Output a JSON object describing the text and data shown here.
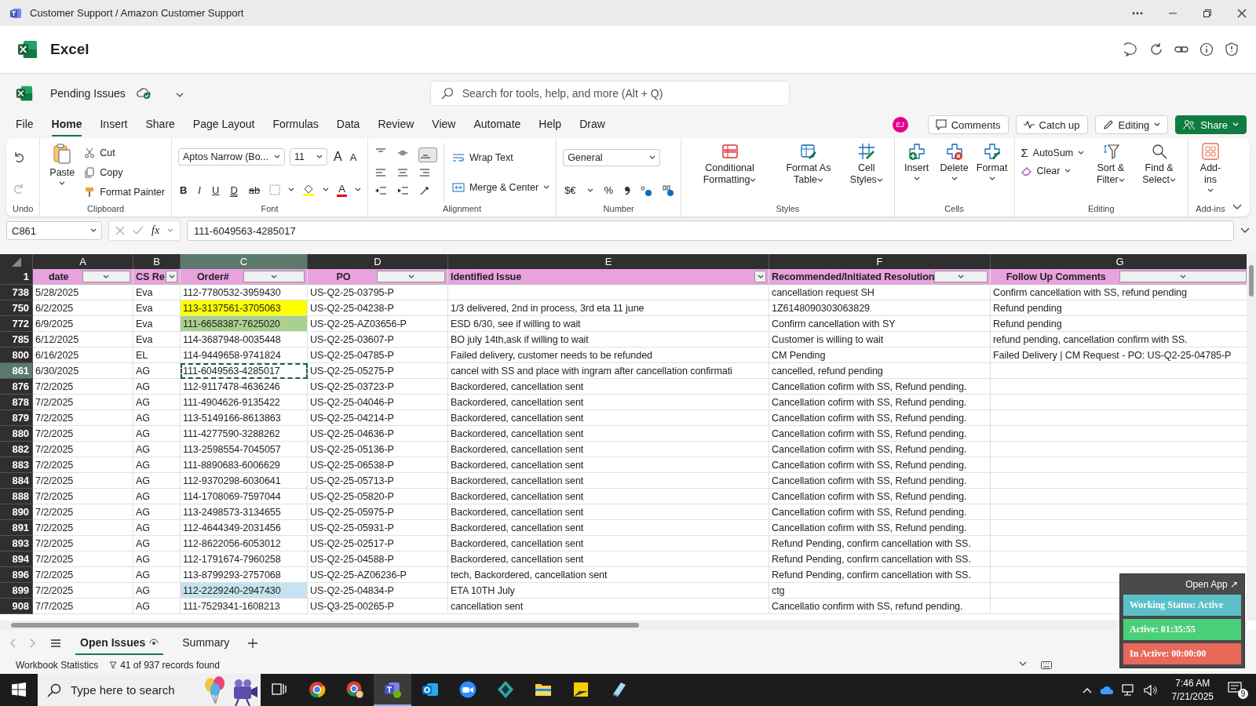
{
  "window": {
    "title": "Customer Support / Amazon Customer Support"
  },
  "app": {
    "name": "Excel"
  },
  "document": {
    "name": "Pending Issues"
  },
  "search": {
    "placeholder": "Search for tools, help, and more (Alt + Q)"
  },
  "menu_tabs": [
    {
      "label": "File",
      "selected": false
    },
    {
      "label": "Home",
      "selected": true
    },
    {
      "label": "Insert",
      "selected": false
    },
    {
      "label": "Share",
      "selected": false
    },
    {
      "label": "Page Layout",
      "selected": false
    },
    {
      "label": "Formulas",
      "selected": false
    },
    {
      "label": "Data",
      "selected": false
    },
    {
      "label": "Review",
      "selected": false
    },
    {
      "label": "View",
      "selected": false
    },
    {
      "label": "Automate",
      "selected": false
    },
    {
      "label": "Help",
      "selected": false
    },
    {
      "label": "Draw",
      "selected": false
    }
  ],
  "user": {
    "initials": "EJ"
  },
  "header_buttons": [
    {
      "kind": "comments",
      "label": "Comments"
    },
    {
      "kind": "catchup",
      "label": "Catch up"
    },
    {
      "kind": "editing",
      "label": "Editing"
    },
    {
      "kind": "share",
      "label": "Share"
    }
  ],
  "ribbon": {
    "undo": {
      "group": "Undo"
    },
    "clipboard": {
      "group": "Clipboard",
      "paste": "Paste",
      "items": [
        "Cut",
        "Copy",
        "Format Painter"
      ]
    },
    "font": {
      "group": "Font",
      "name": "Aptos Narrow (Bo...",
      "size": "11",
      "size_buttons": [
        "A",
        "A"
      ],
      "styles": [
        "B",
        "I",
        "U",
        "D",
        "ab"
      ],
      "color_button": "A"
    },
    "alignment": {
      "group": "Alignment",
      "wrap": "Wrap Text",
      "merge": "Merge & Center"
    },
    "number": {
      "group": "Number",
      "format": "General",
      "currency": "$€",
      "percent": "%"
    },
    "styles": {
      "group": "Styles",
      "items": [
        "Conditional Formatting",
        "Format As Table",
        "Cell Styles"
      ]
    },
    "cells": {
      "group": "Cells",
      "items": [
        "Insert",
        "Delete",
        "Format"
      ]
    },
    "editing": {
      "group": "Editing",
      "sigma": "Σ",
      "autosum": "AutoSum",
      "clear": "Clear",
      "items": [
        "Sort & Filter",
        "Find & Select"
      ]
    },
    "addins": {
      "group": "Add-ins",
      "label": "Add-ins"
    }
  },
  "formula_bar": {
    "cell_ref": "C861",
    "fx": "fx",
    "formula": "111-6049563-4285017"
  },
  "sheet": {
    "columns": [
      {
        "letter": "A",
        "header": "date",
        "selected": false
      },
      {
        "letter": "B",
        "header": "CS Re",
        "selected": false
      },
      {
        "letter": "C",
        "header": "Order#",
        "selected": true
      },
      {
        "letter": "D",
        "header": "PO",
        "selected": false
      },
      {
        "letter": "E",
        "header": "Identified Issue",
        "selected": false
      },
      {
        "letter": "F",
        "header": "Recommended/Initiated Resolution",
        "selected": false
      },
      {
        "letter": "G",
        "header": "Follow Up Comments",
        "selected": false
      }
    ],
    "header_row": "1",
    "rows": [
      {
        "number": "738",
        "selected": false,
        "date": "5/28/2025",
        "cs_rep": "Eva",
        "order": "112-7780532-3959430",
        "po": "US-Q2-25-03795-P",
        "resolution": "cancellation request SH",
        "follow_up": "Confirm cancellation with SS, refund pending"
      },
      {
        "number": "750",
        "selected": false,
        "date": "6/2/2025",
        "cs_rep": "Eva",
        "order": "113-3137561-3705063",
        "color": "#ffff00",
        "po": "US-Q2-25-04238-P",
        "issue": "1/3 delivered, 2nd in process, 3rd eta 11 june",
        "resolution": "1Z6148090303063829",
        "follow_up": "Refund pending"
      },
      {
        "number": "772",
        "selected": false,
        "date": "6/9/2025",
        "cs_rep": "Eva",
        "order": "111-6658387-7625020",
        "color": "#a9d08e",
        "po": "US-Q2-25-AZ03656-P",
        "issue": "ESD 6/30, see if willing to wait",
        "resolution": "Confirm cancellation with SY",
        "follow_up": "Refund pending"
      },
      {
        "number": "785",
        "selected": false,
        "date": "6/12/2025",
        "cs_rep": "Eva",
        "order": "114-3687948-0035448",
        "po": "US-Q2-25-03607-P",
        "issue": "BO july 14th,ask if willing to wait",
        "resolution": "Customer is willing to wait",
        "follow_up": "refund pending, cancellation confirm with SS."
      },
      {
        "number": "800",
        "selected": false,
        "date": "6/16/2025",
        "cs_rep": "EL",
        "order": "114-9449658-9741824",
        "po": "US-Q2-25-04785-P",
        "issue": "Failed delivery, customer needs to be refunded",
        "resolution": "CM Pending",
        "follow_up": "Failed Delivery | CM Request - PO: US-Q2-25-04785-P"
      },
      {
        "number": "861",
        "selected": true,
        "date": "6/30/2025",
        "cs_rep": "AG",
        "order": "111-6049563-4285017",
        "po": "US-Q2-25-05275-P",
        "issue": "cancel with SS and place with ingram after cancellation confirmati",
        "resolution": "cancelled, refund pending"
      },
      {
        "number": "876",
        "selected": false,
        "date": "7/2/2025",
        "cs_rep": "AG",
        "order": "112-9117478-4636246",
        "po": "US-Q2-25-03723-P",
        "issue": "Backordered, cancellation sent",
        "resolution": "Cancellation cofirm with SS, Refund pending."
      },
      {
        "number": "878",
        "selected": false,
        "date": "7/2/2025",
        "cs_rep": "AG",
        "order": "111-4904626-9135422",
        "po": "US-Q2-25-04046-P",
        "issue": "Backordered, cancellation sent",
        "resolution": "Cancellation cofirm with SS, Refund pending."
      },
      {
        "number": "879",
        "selected": false,
        "date": "7/2/2025",
        "cs_rep": "AG",
        "order": "113-5149166-8613863",
        "po": "US-Q2-25-04214-P",
        "issue": "Backordered, cancellation sent",
        "resolution": "Cancellation cofirm with SS, Refund pending."
      },
      {
        "number": "880",
        "selected": false,
        "date": "7/2/2025",
        "cs_rep": "AG",
        "order": "111-4277590-3288262",
        "po": "US-Q2-25-04636-P",
        "issue": "Backordered, cancellation sent",
        "resolution": "Cancellation cofirm with SS, Refund pending."
      },
      {
        "number": "882",
        "selected": false,
        "date": "7/2/2025",
        "cs_rep": "AG",
        "order": "113-2598554-7045057",
        "po": "US-Q2-25-05136-P",
        "issue": "Backordered, cancellation sent",
        "resolution": "Cancellation cofirm with SS, Refund pending."
      },
      {
        "number": "883",
        "selected": false,
        "date": "7/2/2025",
        "cs_rep": "AG",
        "order": "111-8890683-6006629",
        "po": "US-Q2-25-06538-P",
        "issue": "Backordered, cancellation sent",
        "resolution": "Cancellation cofirm with SS, Refund pending."
      },
      {
        "number": "884",
        "selected": false,
        "date": "7/2/2025",
        "cs_rep": "AG",
        "order": "112-9370298-6030641",
        "po": "US-Q2-25-05713-P",
        "issue": "Backordered, cancellation sent",
        "resolution": "Cancellation cofirm with SS, Refund pending."
      },
      {
        "number": "888",
        "selected": false,
        "date": "7/2/2025",
        "cs_rep": "AG",
        "order": "114-1708069-7597044",
        "po": "US-Q2-25-05820-P",
        "issue": "Backordered, cancellation sent",
        "resolution": "Cancellation cofirm with SS, Refund pending."
      },
      {
        "number": "890",
        "selected": false,
        "date": "7/2/2025",
        "cs_rep": "AG",
        "order": "113-2498573-3134655",
        "po": "US-Q2-25-05975-P",
        "issue": "Backordered, cancellation sent",
        "resolution": "Cancellation cofirm with SS, Refund pending."
      },
      {
        "number": "891",
        "selected": false,
        "date": "7/2/2025",
        "cs_rep": "AG",
        "order": "112-4644349-2031456",
        "po": "US-Q2-25-05931-P",
        "issue": "Backordered, cancellation sent",
        "resolution": "Cancellation cofirm with SS, Refund pending."
      },
      {
        "number": "893",
        "selected": false,
        "date": "7/2/2025",
        "cs_rep": "AG",
        "order": "112-8622056-6053012",
        "po": "US-Q2-25-02517-P",
        "issue": "Backordered, cancellation sent",
        "resolution": "Refund Pending, confirm cancellation with SS."
      },
      {
        "number": "894",
        "selected": false,
        "date": "7/2/2025",
        "cs_rep": "AG",
        "order": "112-1791674-7960258",
        "po": "US-Q2-25-04588-P",
        "issue": "Backordered, cancellation sent",
        "resolution": "Refund Pending, confirm cancellation with SS."
      },
      {
        "number": "896",
        "selected": false,
        "date": "7/2/2025",
        "cs_rep": "AG",
        "order": "113-8799293-2757068",
        "po": "US-Q2-25-AZ06236-P",
        "issue": "tech, Backordered, cancellation sent",
        "resolution": "Refund Pending, confirm cancellation with SS."
      },
      {
        "number": "899",
        "selected": false,
        "date": "7/2/2025",
        "cs_rep": "AG",
        "order": "112-2229240-2947430",
        "color": "#c5e3f0",
        "po": "US-Q2-25-04834-P",
        "issue": "ETA 10TH July",
        "resolution": "ctg"
      },
      {
        "number": "908",
        "selected": false,
        "date": "7/7/2025",
        "cs_rep": "AG",
        "order": "111-7529341-1608213",
        "po": "US-Q3-25-00265-P",
        "issue": "cancellation sent",
        "resolution": "Cancellatio confirm with SS, refund pending."
      }
    ]
  },
  "sheet_tabs": [
    {
      "label": "Open Issues",
      "selected": true
    },
    {
      "label": "Summary",
      "selected": false
    }
  ],
  "status_bar": {
    "statistics": "Workbook Statistics",
    "records": "41 of 937 records found"
  },
  "tracker": {
    "open_app": "Open App ↗",
    "status": "Working Status: Active",
    "active": "Active: 01:35:55",
    "inactive": "In Active: 00:00:00"
  },
  "taskbar": {
    "search_placeholder": "Type here to search",
    "time": "7:46 AM",
    "date": "7/21/2025",
    "notifications": "9",
    "apps": [
      {
        "kind": "taskview",
        "selected": false
      },
      {
        "kind": "chrome",
        "selected": false
      },
      {
        "kind": "chrome-profile",
        "selected": false
      },
      {
        "kind": "teams",
        "selected": true
      },
      {
        "kind": "outlook",
        "selected": false
      },
      {
        "kind": "zoom",
        "selected": false
      },
      {
        "kind": "diamond",
        "selected": false
      },
      {
        "kind": "folder",
        "selected": false
      },
      {
        "kind": "notes",
        "selected": false
      },
      {
        "kind": "pad",
        "selected": false
      }
    ]
  }
}
